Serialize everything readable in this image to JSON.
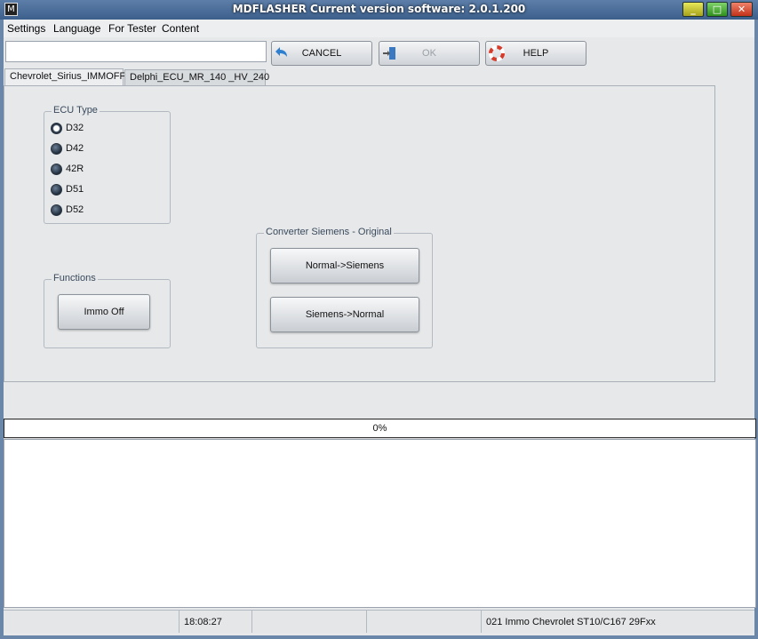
{
  "window": {
    "title": "MDFLASHER  Current version software: 2.0.1.200",
    "app_icon_glyph": "M",
    "min_glyph": "_",
    "max_glyph": "□",
    "close_glyph": "✕"
  },
  "menu": {
    "items": [
      "Settings",
      "Language",
      "For Tester",
      "Content"
    ]
  },
  "toolbar": {
    "address_value": "",
    "cancel_label": "CANCEL",
    "ok_label": "OK",
    "help_label": "HELP"
  },
  "tabs": [
    {
      "label": "Chevrolet_Sirius_IMMOFF",
      "active": true
    },
    {
      "label": "Delphi_ECU_MR_140 _HV_240",
      "active": false
    }
  ],
  "ecu_type": {
    "title": "ECU Type",
    "options": [
      "D32",
      "D42",
      "42R",
      "D51",
      "D52"
    ],
    "selected": "D32"
  },
  "functions": {
    "title": "Functions",
    "immo_off_label": "Immo Off"
  },
  "converter": {
    "title": "Converter Siemens - Original",
    "normal_to_siemens_label": "Normal->Siemens",
    "siemens_to_normal_label": "Siemens->Normal"
  },
  "progress": {
    "text": "0%",
    "value": 0
  },
  "status": {
    "time": "18:08:27",
    "info": "021 Immo Chevrolet ST10/C167 29Fxx"
  },
  "colors": {
    "titlebar": "#3c5f8c",
    "client_bg": "#e6e8ea",
    "min_button": "#d6d230",
    "max_button": "#4fae3a",
    "close_button": "#d84a2e"
  }
}
